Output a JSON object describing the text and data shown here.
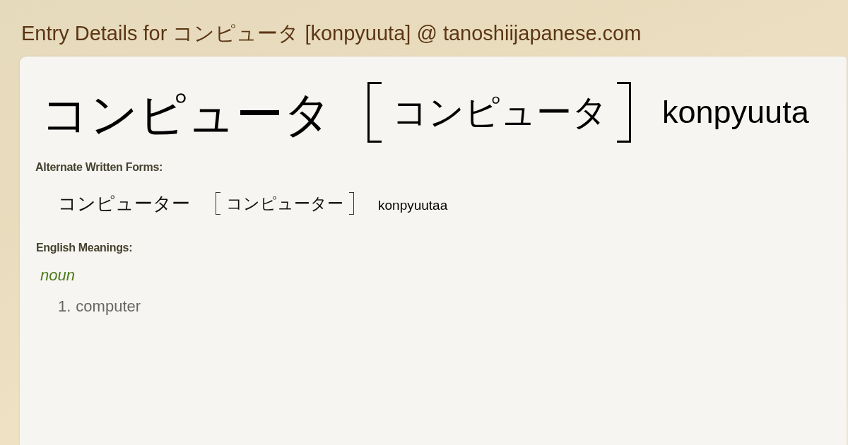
{
  "page": {
    "title": "Entry Details for コンピュータ [konpyuuta] @ tanoshiijapanese.com"
  },
  "entry": {
    "word": "コンピュータ",
    "reading": "コンピュータ",
    "romaji": "konpyuuta"
  },
  "alternate_forms": {
    "heading": "Alternate Written Forms:",
    "items": [
      {
        "word": "コンピューター",
        "reading": "コンピューター",
        "romaji": "konpyuutaa"
      }
    ]
  },
  "meanings": {
    "heading": "English Meanings:",
    "groups": [
      {
        "part_of_speech": "noun",
        "senses": [
          {
            "number": "1.",
            "text": "computer"
          }
        ]
      }
    ]
  }
}
